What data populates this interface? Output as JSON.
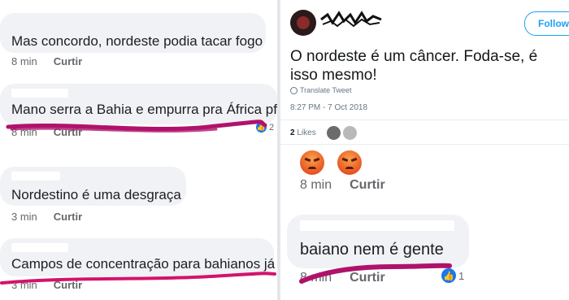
{
  "facebook_comments": [
    {
      "text": "Mas concordo, nordeste podia tacar fogo",
      "time": "8 min",
      "action": "Curtir"
    },
    {
      "text": "Mano serra a Bahia e empurra pra África pf",
      "time": "8 min",
      "action": "Curtir",
      "reaction_count": "2"
    },
    {
      "text": "Nordestino é uma desgraça",
      "time": "3 min",
      "action": "Curtir"
    },
    {
      "text": "Campos de concentração para bahianos já",
      "time": "3 min",
      "action": "Curtir"
    }
  ],
  "tweet": {
    "follow_label": "Follow",
    "text": "O nordeste é um câncer. Foda-se, é isso mesmo!",
    "translate_label": "Translate Tweet",
    "timestamp": "8:27 PM - 7 Oct 2018",
    "likes_count": "2",
    "likes_label": "Likes"
  },
  "reaction_block": {
    "time": "8 min",
    "action": "Curtir"
  },
  "right_comment": {
    "text": "baiano nem é gente",
    "time": "8 min",
    "action": "Curtir",
    "reaction_count": "1"
  },
  "colors": {
    "scribble": "#b0126b",
    "facebook_blue": "#1877f2",
    "twitter_blue": "#1da1f2"
  },
  "icons": [
    "globe-icon",
    "like-reaction-icon",
    "angry-reaction-icon"
  ]
}
